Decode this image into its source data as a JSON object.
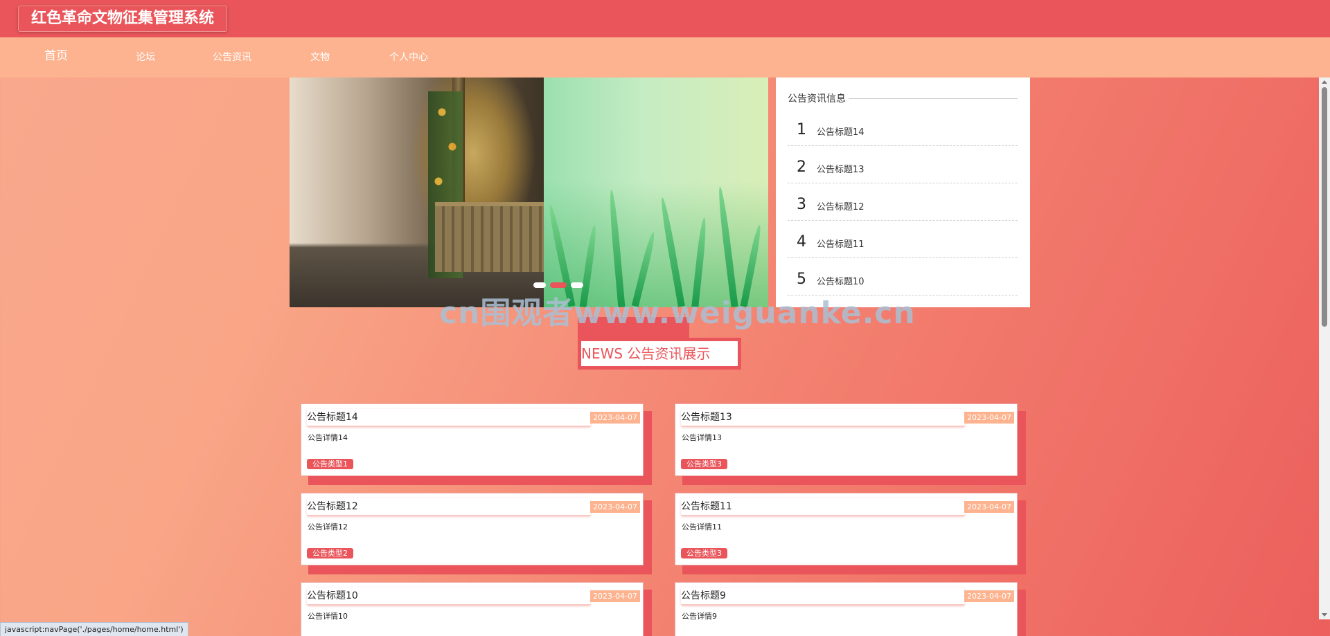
{
  "header": {
    "title": "红色革命文物征集管理系统"
  },
  "nav": {
    "items": [
      {
        "label": "首页",
        "active": true
      },
      {
        "label": "论坛"
      },
      {
        "label": "公告资讯"
      },
      {
        "label": "文物"
      },
      {
        "label": "个人中心"
      }
    ]
  },
  "carousel": {
    "dots": 3,
    "active_index": 1
  },
  "notice_panel": {
    "heading": "公告资讯信息",
    "items": [
      {
        "num": "1",
        "title": "公告标题14"
      },
      {
        "num": "2",
        "title": "公告标题13"
      },
      {
        "num": "3",
        "title": "公告标题12"
      },
      {
        "num": "4",
        "title": "公告标题11"
      },
      {
        "num": "5",
        "title": "公告标题10"
      }
    ]
  },
  "watermark": "cn围观者www.weiguanke.cn",
  "news_section": {
    "title": "NEWS 公告资讯展示",
    "cards": [
      {
        "title": "公告标题14",
        "date": "2023-04-07",
        "desc": "公告详情14",
        "tag": "公告类型1"
      },
      {
        "title": "公告标题13",
        "date": "2023-04-07",
        "desc": "公告详情13",
        "tag": "公告类型3"
      },
      {
        "title": "公告标题12",
        "date": "2023-04-07",
        "desc": "公告详情12",
        "tag": "公告类型2"
      },
      {
        "title": "公告标题11",
        "date": "2023-04-07",
        "desc": "公告详情11",
        "tag": "公告类型3"
      },
      {
        "title": "公告标题10",
        "date": "2023-04-07",
        "desc": "公告详情10",
        "tag": ""
      },
      {
        "title": "公告标题9",
        "date": "2023-04-07",
        "desc": "公告详情9",
        "tag": ""
      }
    ]
  },
  "status_bar": {
    "url": "javascript:navPage('./pages/home/home.html')"
  },
  "colors": {
    "primary": "#e9555a",
    "secondary": "#fdb38f",
    "panel": "#ffffff"
  }
}
